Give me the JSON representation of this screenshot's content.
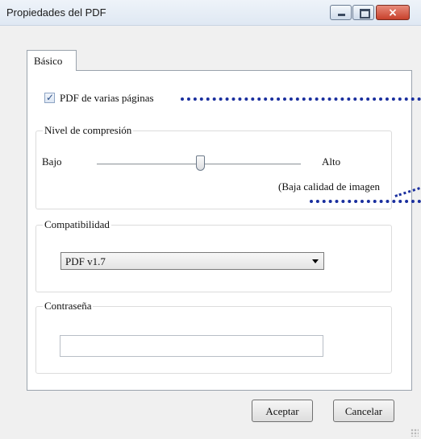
{
  "window": {
    "title": "Propiedades del PDF",
    "close_glyph": "×"
  },
  "tabs": [
    {
      "label": "Básico"
    }
  ],
  "multipage": {
    "label": "PDF de varias páginas",
    "checked": true
  },
  "compression": {
    "group_label": "Nivel de compresión",
    "low_label": "Bajo",
    "high_label": "Alto",
    "note": "(Baja calidad de imagen",
    "level": 0.5
  },
  "compatibility": {
    "group_label": "Compatibilidad",
    "selected": "PDF v1.7"
  },
  "password": {
    "group_label": "Contraseña",
    "value": ""
  },
  "buttons": {
    "ok": "Aceptar",
    "cancel": "Cancelar"
  },
  "colors": {
    "dotted_line": "#1a2f9e",
    "close_button": "#c7412c"
  },
  "icons": {
    "checkbox": "checkmark-icon",
    "minimize": "minimize-icon",
    "maximize": "maximize-icon",
    "close": "close-icon",
    "dropdown": "chevron-down-icon",
    "resize": "resize-grip-icon"
  }
}
